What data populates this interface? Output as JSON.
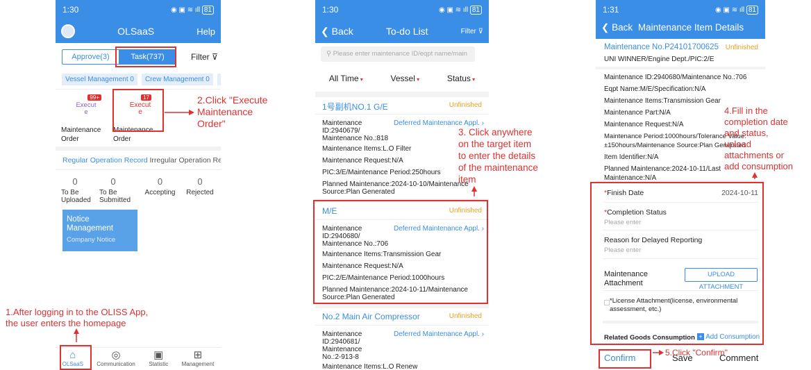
{
  "p1": {
    "time": "1:30",
    "battery": "81",
    "title": "OLSaaS",
    "help": "Help",
    "tab_approve": "Approve(3)",
    "tab_task": "Task(737)",
    "filter": "Filter",
    "chips": [
      "Vessel Management 0",
      "Crew Management 0",
      "M"
    ],
    "exec1_badge": "99+",
    "exec1": "Execut\ne",
    "exec2_badge": "17",
    "exec2": "Execut\ne",
    "lbl1": "Maintenance\nOrder",
    "lbl2": "Maintenance\nOrder",
    "rec_tab1": "Regular Operation Record",
    "rec_tab2": "Irregular Operation Record",
    "stats": [
      {
        "n": "0",
        "l": "To Be\nUploaded"
      },
      {
        "n": "0",
        "l": "To Be\nSubmitted"
      },
      {
        "n": "0",
        "l": "Accepting"
      },
      {
        "n": "0",
        "l": "Rejected"
      }
    ],
    "notice_title": "Notice\nManagement",
    "notice_sub": "Company Notice",
    "nav": [
      "OLSaaS",
      "Communication",
      "Statistic",
      "Management"
    ]
  },
  "p2": {
    "time": "1:30",
    "battery": "81",
    "back": "Back",
    "title": "To-do List",
    "filter": "Filter",
    "search_ph": "Please enter maintenance ID/eqpt name/main",
    "filters": [
      "All Time",
      "Vessel",
      "Status"
    ],
    "items": [
      {
        "name": "1号副机NO.1 G/E",
        "status": "Unfinished",
        "id": "Maintenance\nID:2940679/\nMaintenance No.:818",
        "deferred": "Deferred Maintenance Appl.",
        "lines": [
          "Maintenance Items:L.O Filter",
          "Maintenance Request:N/A",
          "PIC:3/E/Maintenance Period:250hours",
          "Planned Maintenance:2024-10-10/Maintenance\nSource:Plan Generated"
        ]
      },
      {
        "name": "M/E",
        "status": "Unfinished",
        "id": "Maintenance\nID:2940680/\nMaintenance No.:706",
        "deferred": "Deferred Maintenance Appl.",
        "lines": [
          "Maintenance Items:Transmission Gear",
          "Maintenance Request:N/A",
          "PIC:2/E/Maintenance Period:1000hours",
          "Planned Maintenance:2024-10-11/Maintenance\nSource:Plan Generated"
        ]
      },
      {
        "name": "No.2 Main Air Compressor",
        "status": "Unfinished",
        "id": "Maintenance\nID:2940681/\nMaintenance\nNo.:2-913-8",
        "deferred": "Deferred Maintenance Appl.",
        "lines": [
          "Maintenance Items:L.O Renew"
        ]
      }
    ]
  },
  "p3": {
    "time": "1:31",
    "battery": "81",
    "back": "Back",
    "title": "Maintenance Item Details",
    "no": "Maintenance No.P24101700625",
    "status": "Unfinished",
    "ship": "UNI WINNER/Engine Dept./PIC:2/E",
    "details": [
      "Maintenance ID:2940680/Maintenance No.:706",
      "Eqpt Name:M/E/Specification:N/A",
      "Maintenance Items:Transmission Gear",
      "Maintenance Part:N/A",
      "Maintenance Request:N/A",
      "Maintenance Period:1000hours/Tolerance Value:\n±150hours/Maintenance Source:Plan Generated",
      "Item Identifier:N/A",
      "Planned Maintenance:2024-10-11/Last\nMaintenance:N/A"
    ],
    "finish_label": "Finish Date",
    "finish_val": "2024-10-11",
    "comp_label": "Completion Status",
    "comp_ph": "Please enter",
    "delay_label": "Reason for Delayed Reporting",
    "delay_ph": "Please enter",
    "attach_label": "Maintenance\nAttachment",
    "upload": "UPLOAD ATTACHMENT",
    "license": "*License Attachment(license, environmental\nassessment, etc.)",
    "goods": "Related Goods Consumption",
    "add": "Add Consumption",
    "confirm": "Confirm",
    "save": "Save",
    "comment": "Comment"
  },
  "ann": {
    "a1": "1.After logging in to the OLISS App,\nthe user enters the homepage",
    "a2": "2.Click \"Execute\nMaintenance\nOrder\"",
    "a3": "3. Click anywhere\non the target item\nto enter the details\nof the maintenance\nitem",
    "a4": "4.Fill in the\ncompletion date\nand status,\nupload\nattachments or\nadd consumption",
    "a5": "5.Click \"Confirm\""
  }
}
